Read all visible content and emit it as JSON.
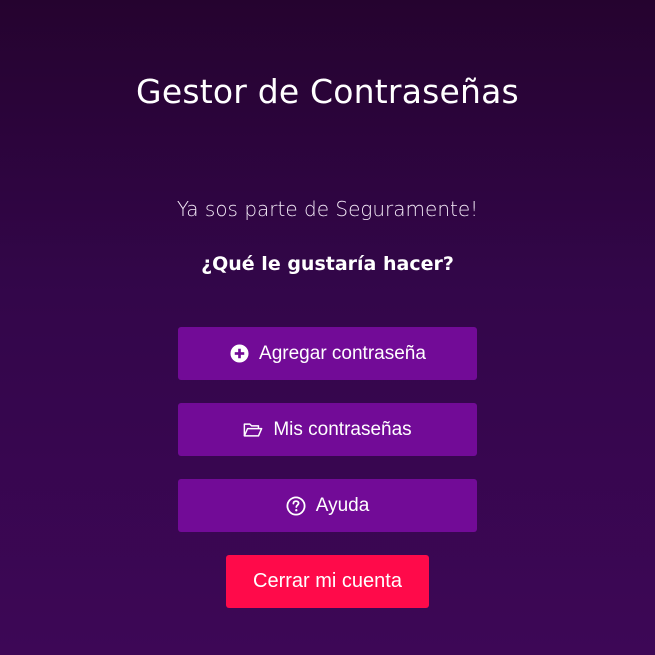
{
  "header": {
    "title": "Gestor de Contraseñas"
  },
  "main": {
    "welcome_text": "Ya sos parte de Seguramente!",
    "question_text": "¿Qué le gustaría hacer?",
    "buttons": {
      "add_password": {
        "label": "Agregar contraseña",
        "icon": "plus-circle-icon"
      },
      "my_passwords": {
        "label": "Mis contraseñas",
        "icon": "folder-open-icon"
      },
      "help": {
        "label": "Ayuda",
        "icon": "question-circle-icon"
      },
      "close_account": {
        "label": "Cerrar mi cuenta"
      }
    }
  },
  "colors": {
    "background": "#2f0440",
    "primary_button": "#720b97",
    "danger_button": "#ff0a4a",
    "text": "#ffffff"
  }
}
